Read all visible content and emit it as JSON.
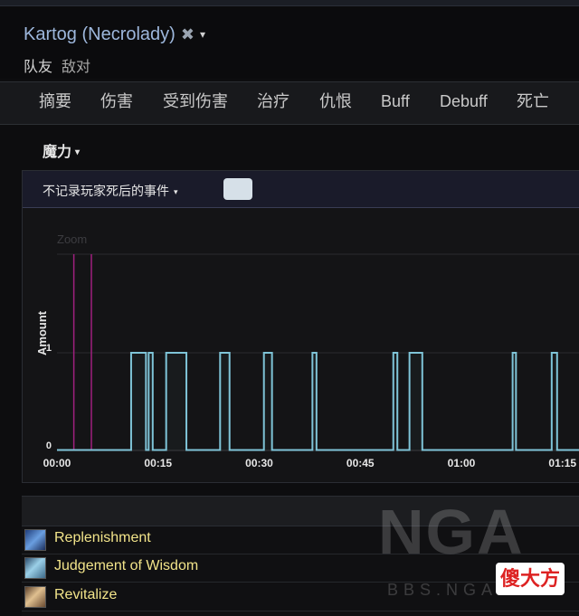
{
  "header": {
    "title": "Kartog (Necrolady)",
    "close_glyph": "✖",
    "caret_glyph": "▾",
    "tabs": [
      "队友",
      "敌对"
    ]
  },
  "nav": {
    "tabs": [
      "摘要",
      "伤害",
      "受到伤害",
      "治疗",
      "仇恨",
      "Buff",
      "Debuff",
      "死亡"
    ]
  },
  "resource": {
    "label": "魔力"
  },
  "filter": {
    "label": "不记录玩家死后的事件"
  },
  "chart_data": {
    "type": "line",
    "title": "Zoom",
    "ylabel": "Amount",
    "xlabel": "",
    "ylim": [
      0,
      1
    ],
    "yticks": [
      "0",
      "1"
    ],
    "xticks": [
      "00:00",
      "00:15",
      "00:30",
      "00:45",
      "01:00",
      "01:15"
    ],
    "x_unit": "seconds",
    "grid": true,
    "series_color": "#7fc4d8",
    "marker_color": "#a0207f",
    "markers": [
      2.5,
      5.1
    ],
    "pulses": [
      [
        11,
        13.2
      ],
      [
        13.6,
        14.2
      ],
      [
        16.2,
        19.2
      ],
      [
        24.2,
        25.6
      ],
      [
        30.7,
        31.9
      ],
      [
        37.9,
        38.5
      ],
      [
        49.9,
        50.5
      ],
      [
        52.3,
        54.2
      ],
      [
        67.6,
        68.1
      ],
      [
        73.4,
        74.2
      ]
    ]
  },
  "spells": [
    {
      "name": "Replenishment",
      "icon": "replenishment-icon"
    },
    {
      "name": "Judgement of Wisdom",
      "icon": "judgement-icon"
    },
    {
      "name": "Revitalize",
      "icon": "revitalize-icon"
    }
  ],
  "watermark": {
    "logo": "NGA",
    "site": "BBS.NGA.CN",
    "badge": "傻大方"
  }
}
